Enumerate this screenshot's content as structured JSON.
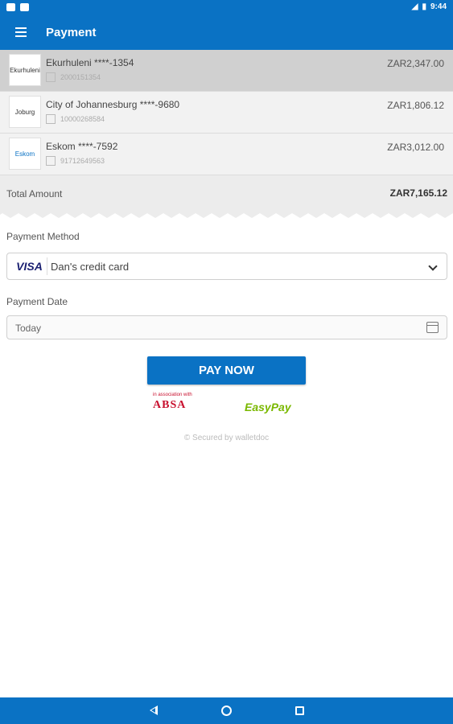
{
  "status_bar": {
    "time": "9:44"
  },
  "app_bar": {
    "title": "Payment"
  },
  "bills": [
    {
      "logo": "Ekurhuleni",
      "name": "Ekurhuleni ****-1354",
      "reference": "2000151354",
      "amount": "ZAR2,347.00",
      "selected": true
    },
    {
      "logo": "Joburg",
      "name": "City of Johannesburg ****-9680",
      "reference": "10000268584",
      "amount": "ZAR1,806.12",
      "selected": false
    },
    {
      "logo": "Eskom",
      "name": "Eskom ****-7592",
      "reference": "91712649563",
      "amount": "ZAR3,012.00",
      "selected": false
    }
  ],
  "total": {
    "label": "Total Amount",
    "value": "ZAR7,165.12"
  },
  "payment_method": {
    "label": "Payment Method",
    "card_brand": "VISA",
    "selected": "Dan's credit card"
  },
  "payment_date": {
    "label": "Payment Date",
    "value": "Today"
  },
  "pay_button": {
    "label": "PAY NOW"
  },
  "partners": {
    "absa_assoc": "in association with",
    "absa": "ABSA",
    "easypay": "EasyPay"
  },
  "footer": {
    "secured": "© Secured by walletdoc"
  },
  "colors": {
    "primary": "#0a72c4",
    "absa_red": "#c8102e",
    "easypay_green": "#7ab800"
  }
}
